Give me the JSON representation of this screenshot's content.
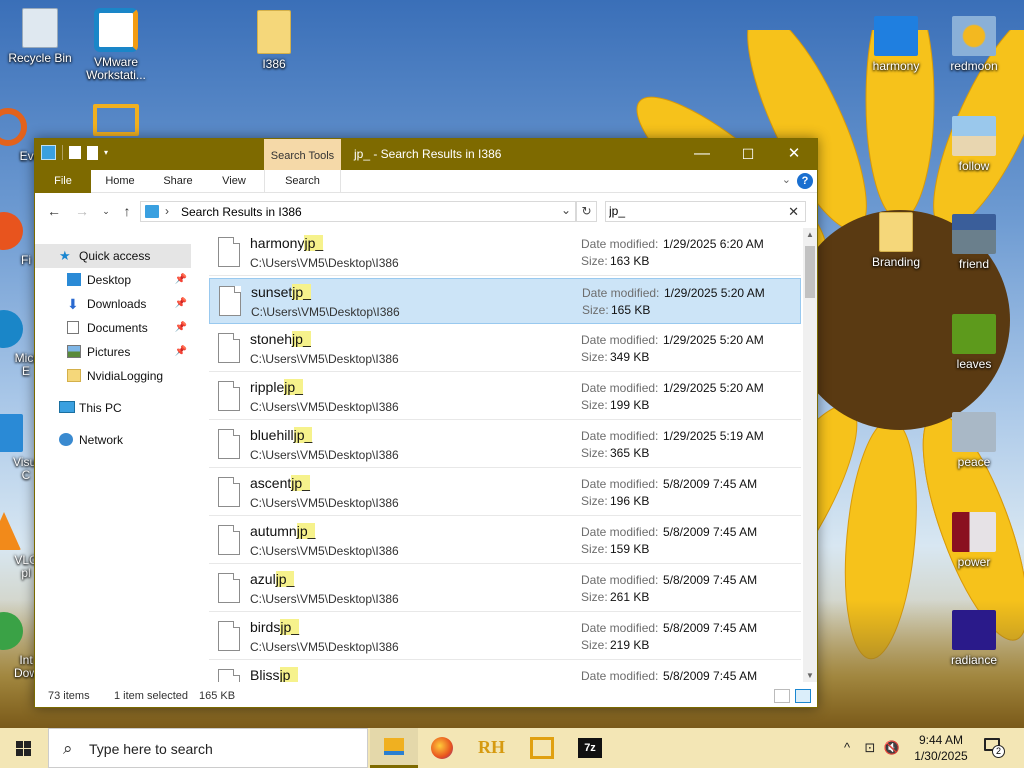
{
  "desktop": {
    "icons_left": [
      {
        "label": "Recycle Bin"
      },
      {
        "label": "VMware Workstati..."
      },
      {
        "label": "Eve"
      },
      {
        "label": "Fi"
      },
      {
        "label": "Micr E"
      },
      {
        "label": "Visua C"
      },
      {
        "label": "VLC pl"
      },
      {
        "label": "Int Dow"
      }
    ],
    "icon_i386": "I386",
    "icons_right": [
      {
        "label": "harmony"
      },
      {
        "label": "redmoon"
      },
      {
        "label": "follow"
      },
      {
        "label": "Branding"
      },
      {
        "label": "friend"
      },
      {
        "label": "leaves"
      },
      {
        "label": "peace"
      },
      {
        "label": "power"
      },
      {
        "label": "radiance"
      }
    ]
  },
  "window": {
    "title": "jp_ - Search Results in I386",
    "search_tools_tab": "Search Tools",
    "minimize": "—",
    "maximize": "☐",
    "close": "✕",
    "ribbon_tabs": [
      "File",
      "Home",
      "Share",
      "View",
      "Search"
    ],
    "help": "?",
    "address": {
      "path": "Search Results in I386"
    },
    "search": {
      "value": "jp_"
    },
    "nav": {
      "quick_access": "Quick access",
      "items": [
        {
          "label": "Desktop",
          "pinned": true
        },
        {
          "label": "Downloads",
          "pinned": true
        },
        {
          "label": "Documents",
          "pinned": true
        },
        {
          "label": "Pictures",
          "pinned": true
        },
        {
          "label": "NvidiaLogging",
          "pinned": false
        }
      ],
      "this_pc": "This PC",
      "network": "Network"
    },
    "results": {
      "modified_label": "Date modified:",
      "size_label": "Size:",
      "items": [
        {
          "base": "harmony",
          "ext": "jp_",
          "path": "C:\\Users\\VM5\\Desktop\\I386",
          "modified": "1/29/2025 6:20 AM",
          "size": "163 KB",
          "selected": false
        },
        {
          "base": "sunset",
          "ext": "jp_",
          "path": "C:\\Users\\VM5\\Desktop\\I386",
          "modified": "1/29/2025 5:20 AM",
          "size": "165 KB",
          "selected": true
        },
        {
          "base": "stoneh",
          "ext": "jp_",
          "path": "C:\\Users\\VM5\\Desktop\\I386",
          "modified": "1/29/2025 5:20 AM",
          "size": "349 KB",
          "selected": false
        },
        {
          "base": "ripple",
          "ext": "jp_",
          "path": "C:\\Users\\VM5\\Desktop\\I386",
          "modified": "1/29/2025 5:20 AM",
          "size": "199 KB",
          "selected": false
        },
        {
          "base": "bluehill",
          "ext": "jp_",
          "path": "C:\\Users\\VM5\\Desktop\\I386",
          "modified": "1/29/2025 5:19 AM",
          "size": "365 KB",
          "selected": false
        },
        {
          "base": "ascent",
          "ext": "jp_",
          "path": "C:\\Users\\VM5\\Desktop\\I386",
          "modified": "5/8/2009 7:45 AM",
          "size": "196 KB",
          "selected": false
        },
        {
          "base": "autumn",
          "ext": "jp_",
          "path": "C:\\Users\\VM5\\Desktop\\I386",
          "modified": "5/8/2009 7:45 AM",
          "size": "159 KB",
          "selected": false
        },
        {
          "base": "azul",
          "ext": "jp_",
          "path": "C:\\Users\\VM5\\Desktop\\I386",
          "modified": "5/8/2009 7:45 AM",
          "size": "261 KB",
          "selected": false
        },
        {
          "base": "birds",
          "ext": "jp_",
          "path": "C:\\Users\\VM5\\Desktop\\I386",
          "modified": "5/8/2009 7:45 AM",
          "size": "219 KB",
          "selected": false
        },
        {
          "base": "Bliss",
          "ext": "jp_",
          "path": "",
          "modified": "5/8/2009 7:45 AM",
          "size": "",
          "selected": false
        }
      ]
    },
    "status": {
      "count": "73 items",
      "selected": "1 item selected",
      "selected_size": "165 KB"
    }
  },
  "taskbar": {
    "search_placeholder": "Type here to search",
    "time": "9:44 AM",
    "date": "1/30/2025",
    "notifications": "2",
    "apps": [
      "file-explorer",
      "firefox",
      "rh",
      "network-app",
      "7zip"
    ]
  },
  "colors": {
    "accent": "#7e6a00",
    "selection": "#cce4f7",
    "highlight": "#f6f28c"
  }
}
